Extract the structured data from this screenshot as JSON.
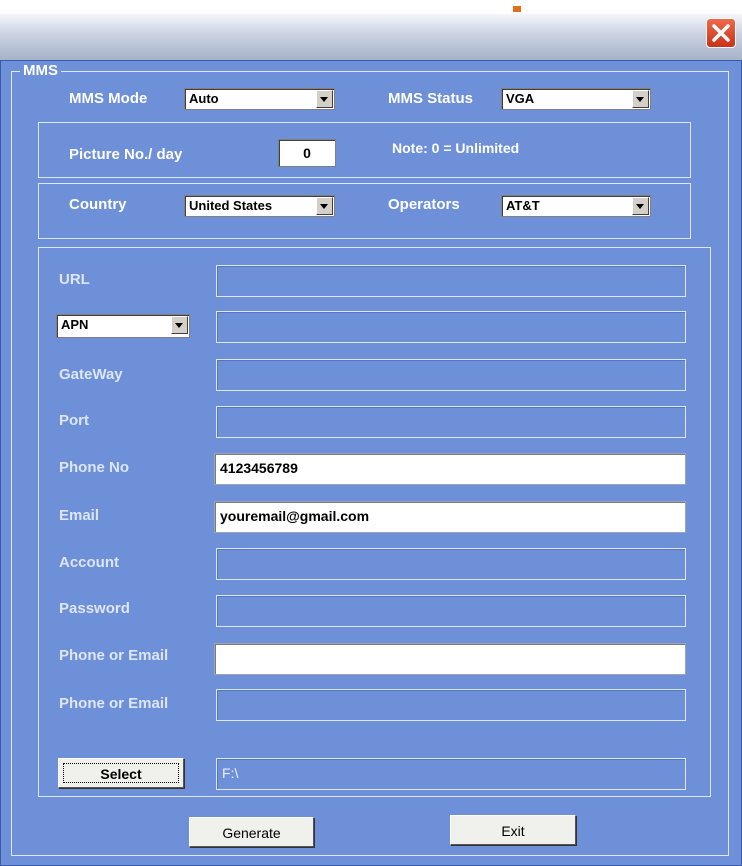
{
  "window": {
    "close_icon": "close-icon"
  },
  "mms": {
    "group_title": "MMS",
    "mode": {
      "label": "MMS Mode",
      "value": "Auto"
    },
    "status": {
      "label": "MMS Status",
      "value": "VGA"
    },
    "picture": {
      "label": "Picture No./ day",
      "value": "0",
      "note": "Note: 0 = Unlimited"
    },
    "country": {
      "label": "Country",
      "value": "United States"
    },
    "operators": {
      "label": "Operators",
      "value": "AT&T"
    }
  },
  "settings": {
    "url": {
      "label": "URL",
      "value": ""
    },
    "apn": {
      "select_value": "APN",
      "value": ""
    },
    "gateway": {
      "label": "GateWay",
      "value": ""
    },
    "port": {
      "label": "Port",
      "value": ""
    },
    "phone": {
      "label": "Phone No",
      "value": "4123456789"
    },
    "email": {
      "label": "Email",
      "value": "youremail@gmail.com"
    },
    "account": {
      "label": "Account",
      "value": ""
    },
    "password": {
      "label": "Password",
      "value": ""
    },
    "phone_or_email_1": {
      "label": "Phone or Email",
      "value": ""
    },
    "phone_or_email_2": {
      "label": "Phone or Email",
      "value": ""
    }
  },
  "path": {
    "select_label": "Select",
    "value": "F:\\"
  },
  "buttons": {
    "generate_label": "Generate",
    "exit_label": "Exit"
  }
}
